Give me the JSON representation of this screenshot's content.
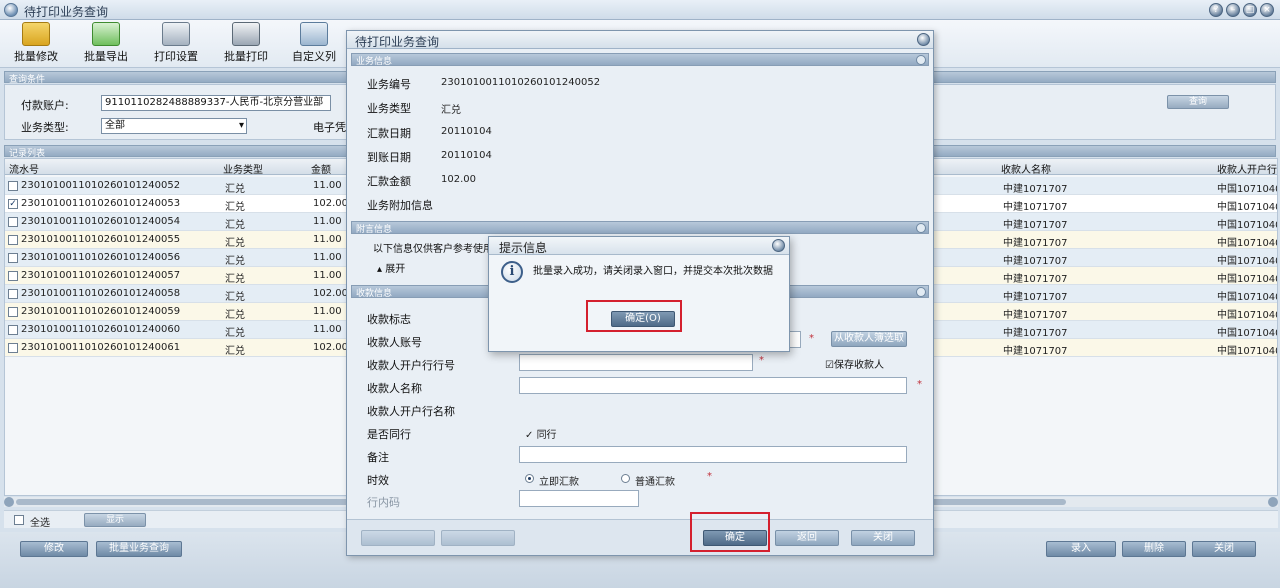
{
  "window": {
    "title": "待打印业务查询"
  },
  "toolbar": {
    "buttons": [
      {
        "label": "批量修改"
      },
      {
        "label": "批量导出"
      },
      {
        "label": "打印设置"
      },
      {
        "label": "批量打印"
      },
      {
        "label": "自定义列"
      }
    ]
  },
  "query": {
    "section_title": "查询条件",
    "account_label": "付款账户:",
    "account_value": "9110110282488889337-人民币-北京分营业部",
    "status_label": "业务类型:",
    "status_value": "全部",
    "extra_label": "电子凭",
    "query_button": "查询"
  },
  "table": {
    "section_title": "记录列表",
    "headers": [
      "流水号",
      "业务类型",
      "金额",
      "收款人名称",
      "收款人开户行"
    ],
    "rows": [
      {
        "id": "2301010011010260101240052",
        "type": "汇兑",
        "amount": "11.00",
        "payee": "中建1071707",
        "bank": "中国1071040"
      },
      {
        "id": "2301010011010260101240053",
        "type": "汇兑",
        "amount": "102.00",
        "payee": "中建1071707",
        "bank": "中国1071040"
      },
      {
        "id": "2301010011010260101240054",
        "type": "汇兑",
        "amount": "11.00",
        "payee": "中建1071707",
        "bank": "中国1071040"
      },
      {
        "id": "2301010011010260101240055",
        "type": "汇兑",
        "amount": "11.00",
        "payee": "中建1071707",
        "bank": "中国1071040"
      },
      {
        "id": "2301010011010260101240056",
        "type": "汇兑",
        "amount": "11.00",
        "payee": "中建1071707",
        "bank": "中国1071040"
      },
      {
        "id": "2301010011010260101240057",
        "type": "汇兑",
        "amount": "11.00",
        "payee": "中建1071707",
        "bank": "中国1071040"
      },
      {
        "id": "2301010011010260101240058",
        "type": "汇兑",
        "amount": "102.00",
        "payee": "中建1071707",
        "bank": "中国1071040"
      },
      {
        "id": "2301010011010260101240059",
        "type": "汇兑",
        "amount": "11.00",
        "payee": "中建1071707",
        "bank": "中国1071040"
      },
      {
        "id": "2301010011010260101240060",
        "type": "汇兑",
        "amount": "11.00",
        "payee": "中建1071707",
        "bank": "中国1071040"
      },
      {
        "id": "2301010011010260101240061",
        "type": "汇兑",
        "amount": "102.00",
        "payee": "中建1071707",
        "bank": "中国1071040"
      }
    ]
  },
  "status": {
    "select_all": "全选",
    "mode_button": "显示"
  },
  "bottom": {
    "left_btn_1": "修改",
    "left_select": "批量业务查询",
    "right_btn_1": "录入",
    "right_btn_2": "删除",
    "right_btn_3": "关闭"
  },
  "dialog": {
    "title": "待打印业务查询",
    "group1": "业务信息",
    "fields": [
      {
        "label": "业务编号",
        "value": "2301010011010260101240052"
      },
      {
        "label": "业务类型",
        "value": "汇兑"
      },
      {
        "label": "汇款日期",
        "value": "20110104"
      },
      {
        "label": "到账日期",
        "value": "20110104"
      },
      {
        "label": "汇款金额",
        "value": "102.00"
      },
      {
        "label": "业务附加信息",
        "value": ""
      }
    ],
    "group2": "附言信息",
    "note_text": "以下信息仅供客户参考使用于",
    "note_toggle": "展开",
    "group3": "收款信息",
    "payee_fields": [
      {
        "label": "收款标志"
      },
      {
        "label": "收款人账号"
      },
      {
        "label": "收款人开户行行号"
      },
      {
        "label": "收款人名称"
      },
      {
        "label": "收款人开户行名称"
      },
      {
        "label": "是否同行"
      },
      {
        "label": "备注"
      },
      {
        "label": "时效"
      },
      {
        "label": "行内码"
      }
    ],
    "lookup_button": "从收款人簿选取",
    "lookup_check": "保存收款人",
    "same_bank": "同行",
    "radio_1": "立即汇款",
    "radio_2": "普通汇款",
    "footer_buttons": [
      "确定",
      "返回",
      "关闭"
    ]
  },
  "alert": {
    "title": "提示信息",
    "message": "批量录入成功，请关闭录入窗口，并提交本次批次数据",
    "ok_button": "确定(O)"
  }
}
